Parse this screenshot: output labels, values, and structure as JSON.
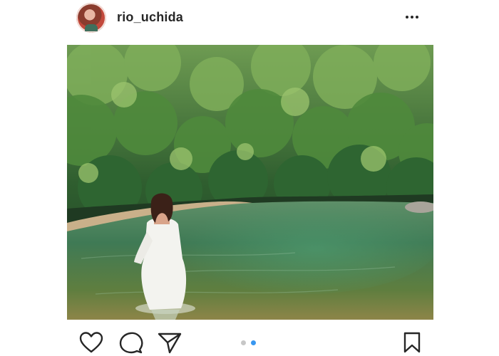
{
  "post": {
    "username": "rio_uchida",
    "carousel": {
      "count": 2,
      "active_index": 2
    }
  },
  "icons": {
    "more": "more-options-icon",
    "like": "heart-icon",
    "comment": "comment-bubble-icon",
    "share": "paper-plane-icon",
    "save": "bookmark-icon"
  },
  "colors": {
    "text": "#262626",
    "dot_active": "#3897f0",
    "dot_inactive": "#c7c7c7"
  }
}
